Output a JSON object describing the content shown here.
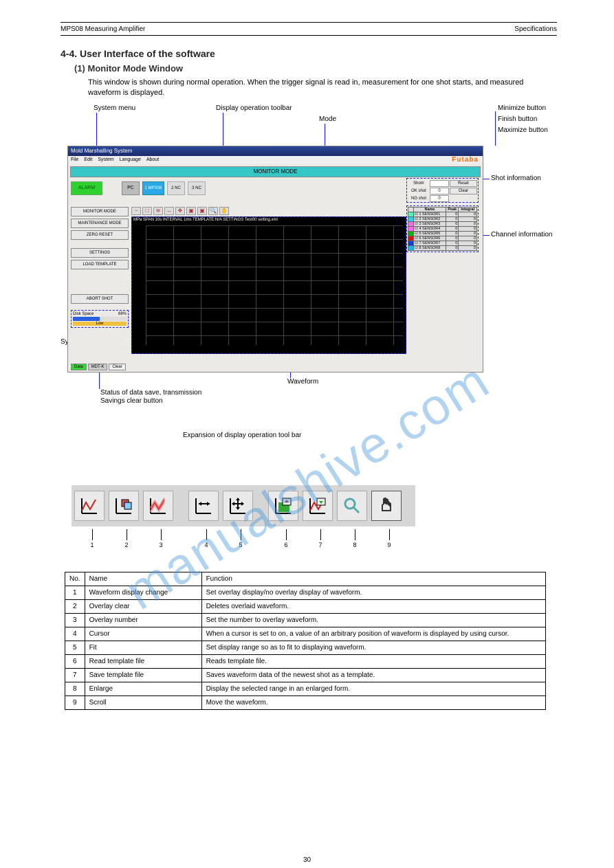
{
  "header": {
    "left": "MPS08 Measuring Amplifier",
    "right": "Specifications"
  },
  "section": {
    "num_title": "4-4. User Interface of the software",
    "sub": "(1) Monitor Mode Window",
    "body": "This window is shown during normal operation. When the trigger signal is read in, measurement for one shot starts, and measured waveform is displayed."
  },
  "diag_labels": {
    "l1": "System menu",
    "l2": "Display operation toolbar",
    "l3": "Mode",
    "l4": "Minimize button",
    "l5": "Finish button",
    "l6": "Maximize button",
    "l7": "Shot information",
    "l8": "Channel information",
    "l9": "Waveform",
    "l10a": "Status of data save, transmission",
    "l10b": "Savings clear button",
    "l11": "System information",
    "toolbar_note": "Expansion of display operation tool bar"
  },
  "app": {
    "title": "Mold Marshalling System",
    "menus": [
      "File",
      "Edit",
      "System",
      "Language",
      "About"
    ],
    "brand": "Futaba",
    "mode": "MONITOR MODE",
    "alarm": "ALARM",
    "pc": "PC",
    "mp": "1 MPS08",
    "nc2": "2 NC",
    "nc3": "3 NC",
    "shot": {
      "r1": "Shot#",
      "v1": "",
      "b1": "Reset",
      "r2": "OK shot",
      "v2": "0",
      "b2": "Clear",
      "r3": "NG shot",
      "v3": "0"
    },
    "left_buttons": [
      "MONITOR MODE",
      "MAINTENANCE MODE",
      "ZERO RESET",
      "SETTINGS",
      "LOAD TEMPLATE",
      "ABORT SHOT"
    ],
    "disk": {
      "label": "Disk Space",
      "pct": "68%",
      "low": "Low"
    },
    "chart_info": "MPa  SPAN 10s INTERVAL 1ms TEMPLATE:N/A SETTINGS Test00 setting.xml",
    "sensor_head": [
      "",
      "Name",
      "Peak",
      "Integral"
    ],
    "sensors": [
      [
        "#57f0b6",
        "1 SENSOR1",
        "0",
        "0"
      ],
      [
        "#38c8f3",
        "2 SENSOR2",
        "0",
        "0"
      ],
      [
        "#e878d6",
        "3 SENSOR3",
        "0",
        "0"
      ],
      [
        "#f96ee8",
        "4 SENSOR4",
        "0",
        "0"
      ],
      [
        "#18a818",
        "5 SENSOR5",
        "0",
        "0"
      ],
      [
        "#c81818",
        "6 SENSOR6",
        "0",
        "0"
      ],
      [
        "#1640c8",
        "7 SENSOR7",
        "0",
        "0"
      ],
      [
        "#22b2e8",
        "8 SENSOR8",
        "0",
        "0"
      ]
    ],
    "status": {
      "data": "Data",
      "mdt": "MDT-K",
      "clear": "Clear"
    }
  },
  "toolbar_ids": [
    "1",
    "2",
    "3",
    "4",
    "5",
    "6",
    "7",
    "8",
    "9"
  ],
  "ref_head": [
    "No.",
    "Name",
    "Function"
  ],
  "ref_rows": [
    [
      "1",
      "Waveform display change",
      "Set overlay display/no overlay display of waveform."
    ],
    [
      "2",
      "Overlay clear",
      "Deletes overlaid waveform."
    ],
    [
      "3",
      "Overlay number",
      "Set the number to overlay waveform."
    ],
    [
      "4",
      "Cursor",
      "When a cursor is set to on, a value of an arbitrary position of waveform is displayed by using cursor."
    ],
    [
      "5",
      "Fit",
      "Set display range so as to fit to displaying waveform."
    ],
    [
      "6",
      "Read template file",
      "Reads template file."
    ],
    [
      "7",
      "Save template file",
      "Saves waveform data of the newest shot as a template."
    ],
    [
      "8",
      "Enlarge",
      "Display the selected range in an enlarged form."
    ],
    [
      "9",
      "Scroll",
      "Move the waveform."
    ]
  ],
  "watermark": "manualshive.com",
  "footer_page": "30"
}
